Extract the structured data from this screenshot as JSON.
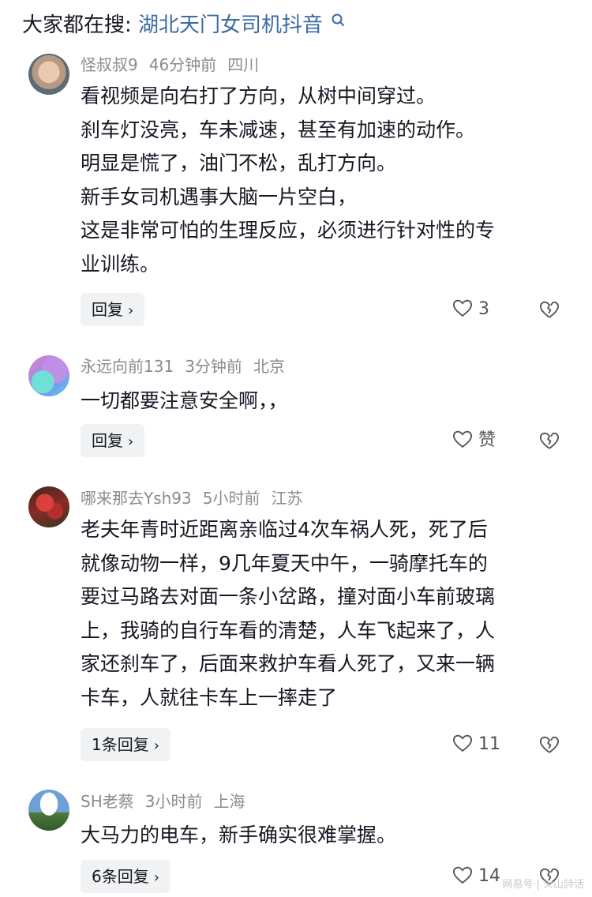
{
  "search": {
    "prefix": "大家都在搜:",
    "query": "湖北天门女司机抖音"
  },
  "comments": [
    {
      "username": "怪叔叔9",
      "time": "46分钟前",
      "location": "四川",
      "lines": [
        "看视频是向右打了方向，从树中间穿过。",
        "刹车灯没亮，车未减速，甚至有加速的动作。",
        "明显是慌了，油门不松，乱打方向。",
        "新手女司机遇事大脑一片空白，",
        "这是非常可怕的生理反应，必须进行针对性的专",
        "业训练。"
      ],
      "reply_label": "回复",
      "like_count": "3"
    },
    {
      "username": "永远向前131",
      "time": "3分钟前",
      "location": "北京",
      "lines": [
        "一切都要注意安全啊，，"
      ],
      "reply_label": "回复",
      "like_count": "赞"
    },
    {
      "username": "哪来那去Ysh93",
      "time": "5小时前",
      "location": "江苏",
      "lines": [
        "老夫年青时近距离亲临过4次车祸人死，死了后",
        "就像动物一样，9几年夏天中午，一骑摩托车的",
        "要过马路去对面一条小岔路，撞对面小车前玻璃",
        "上，我骑的自行车看的清楚，人车飞起来了，人",
        "家还刹车了，后面来救护车看人死了，又来一辆",
        "卡车，人就往卡车上一摔走了"
      ],
      "reply_label": "1条回复",
      "like_count": "11"
    },
    {
      "username": "SH老蔡",
      "time": "3小时前",
      "location": "上海",
      "lines": [
        "大马力的电车，新手确实很难掌握。"
      ],
      "reply_label": "6条回复",
      "like_count": "14"
    }
  ],
  "watermark": "网易号 | 火山詩话",
  "colors": {
    "query_link": "#3a6ba5",
    "meta_gray": "#8a8b91",
    "reply_bg": "#f1f2f4"
  },
  "icons": [
    "search-icon",
    "heart-icon",
    "broken-heart-icon",
    "chevron-right-icon"
  ]
}
